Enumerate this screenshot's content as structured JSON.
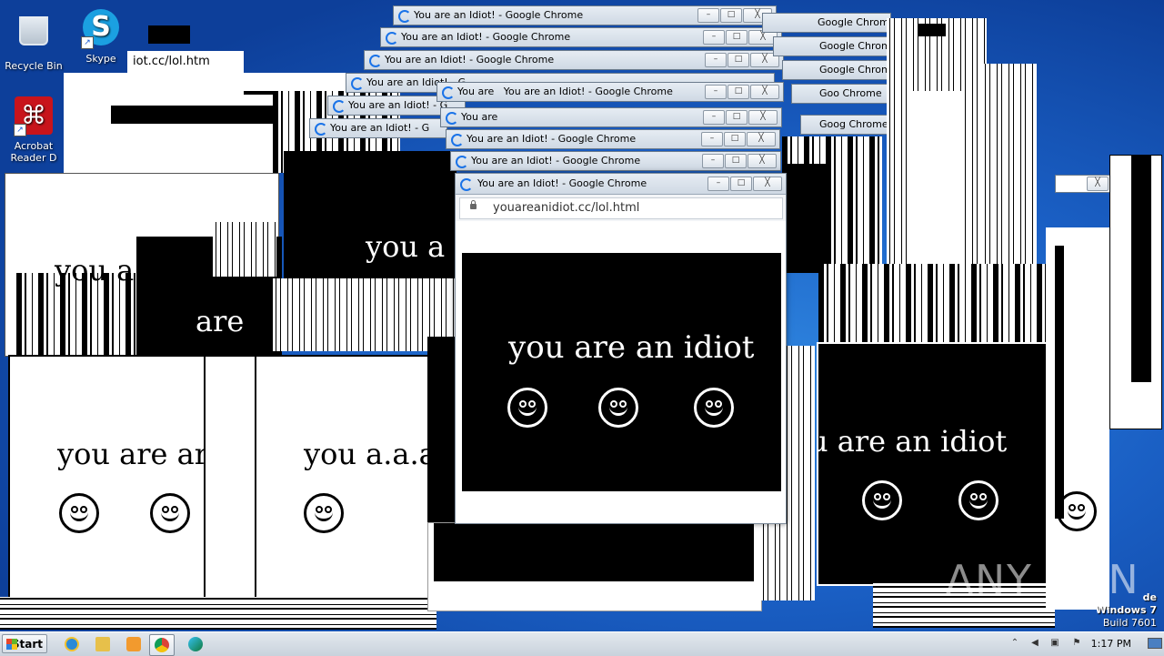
{
  "desktop": {
    "icons": [
      {
        "label": "Recycle Bin",
        "icon": "recycle-bin-icon"
      },
      {
        "label": "Skype",
        "icon": "skype-icon"
      },
      {
        "label": "Acrobat Reader DC",
        "line1": "Acrobat",
        "line2": "Reader D",
        "icon": "acrobat-icon"
      }
    ],
    "partial_url": "iot.cc/lol.htm",
    "watermark": {
      "line1": "de",
      "line2": "Windows 7",
      "line3": "Build 7601"
    },
    "anyrun_logo": "ANY RUN"
  },
  "popup": {
    "window_title": "You are an Idiot! - Google Chrome",
    "title_fragments": [
      "You are an Idiot! - G",
      "You are",
      "Google Chrome",
      "Goo Chrome",
      "Goog Chrome"
    ],
    "url": "youareanidiot.cc/lol.html",
    "message": "you are an idiot",
    "message_fragments": [
      "you are ar",
      "you a.a.a",
      "you ar",
      "you a",
      "are",
      "u are an idiot"
    ],
    "minimize": "–",
    "maximize": "□",
    "close": "╳"
  },
  "taskbar": {
    "start_label": "Start",
    "pinned": [
      "internet-explorer-icon",
      "file-explorer-icon",
      "media-player-icon",
      "chrome-icon",
      "edge-icon"
    ],
    "clock": "1:17 PM",
    "tray": [
      "show-hidden-icons",
      "volume-icon",
      "network-icon",
      "action-center-flag-icon"
    ]
  },
  "colors": {
    "desktop_blue": "#1a5fc4",
    "chrome_blue": "#1a73e8",
    "taskbar": "#d4dbe3"
  }
}
